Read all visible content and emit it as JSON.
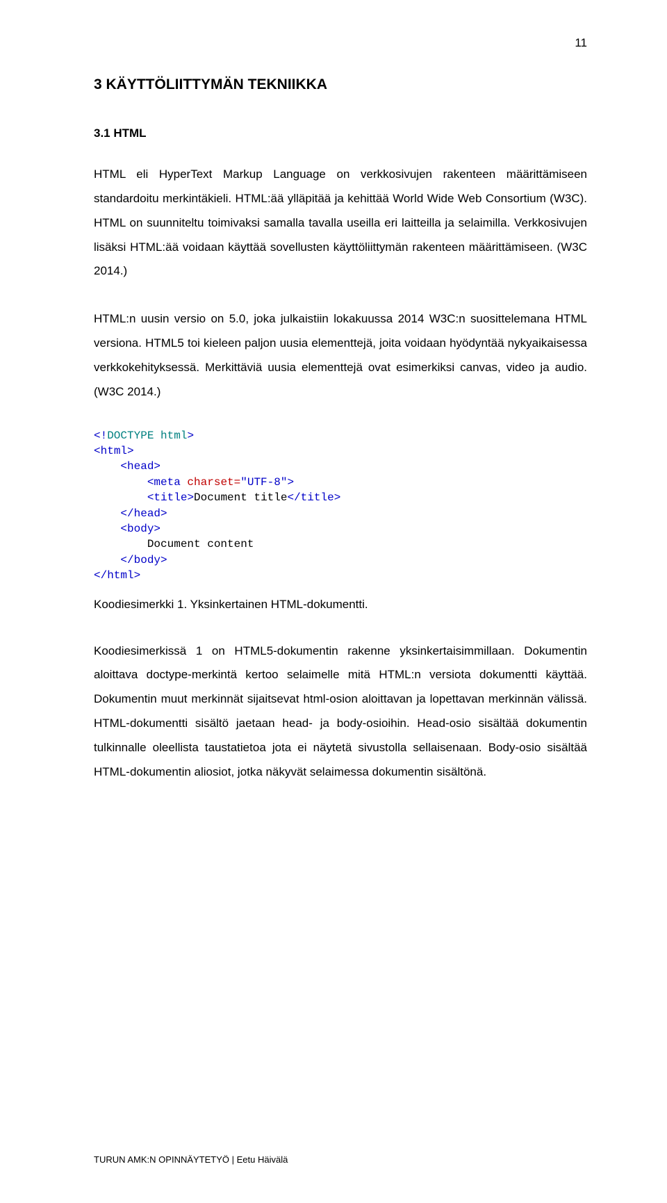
{
  "page_number": "11",
  "heading": "3 KÄYTTÖLIITTYMÄN TEKNIIKKA",
  "subheading": "3.1 HTML",
  "para1": "HTML eli HyperText Markup Language on verkkosivujen rakenteen määrittämiseen standardoitu merkintäkieli. HTML:ää ylläpitää ja kehittää World Wide Web Consortium (W3C). HTML on suunniteltu toimivaksi samalla tavalla useilla eri laitteilla ja selaimilla. Verkkosivujen lisäksi HTML:ää voidaan käyttää sovellusten käyttöliittymän rakenteen määrittämiseen. (W3C 2014.)",
  "para2": "HTML:n uusin versio on 5.0, joka julkaistiin lokakuussa 2014 W3C:n suosittelemana HTML versiona. HTML5 toi kieleen paljon uusia elementtejä, joita voidaan hyödyntää nykyaikaisessa verkkokehityksessä. Merkittäviä uusia elementtejä ovat esimerkiksi canvas, video ja audio. (W3C 2014.)",
  "code": {
    "doctype_open": "<!",
    "doctype_word": "DOCTYPE",
    "doctype_html": " html",
    "doctype_close": ">",
    "tag_open": "<",
    "tag_close": ">",
    "tag_slash": "</",
    "html": "html",
    "head": "head",
    "meta": "meta",
    "charset_attr": " charset=",
    "charset_val": "\"UTF-8\"",
    "title": "title",
    "title_text": "Document title",
    "body": "body",
    "body_text": "Document content",
    "indent1": "    ",
    "indent2": "        "
  },
  "caption": "Koodiesimerkki 1. Yksinkertainen HTML-dokumentti.",
  "para3": "Koodiesimerkissä 1 on HTML5-dokumentin rakenne yksinkertaisimmillaan. Dokumentin aloittava doctype-merkintä kertoo selaimelle mitä HTML:n versiota dokumentti käyttää. Dokumentin muut merkinnät sijaitsevat html-osion aloittavan ja lopettavan merkinnän välissä. HTML-dokumentti sisältö jaetaan head- ja body-osioihin. Head-osio sisältää dokumentin tulkinnalle oleellista taustatietoa jota ei näytetä sivustolla sellaisenaan. Body-osio sisältää HTML-dokumentin aliosiot, jotka näkyvät selaimessa dokumentin sisältönä.",
  "footer": "TURUN AMK:N OPINNÄYTETYÖ | Eetu Häivälä"
}
